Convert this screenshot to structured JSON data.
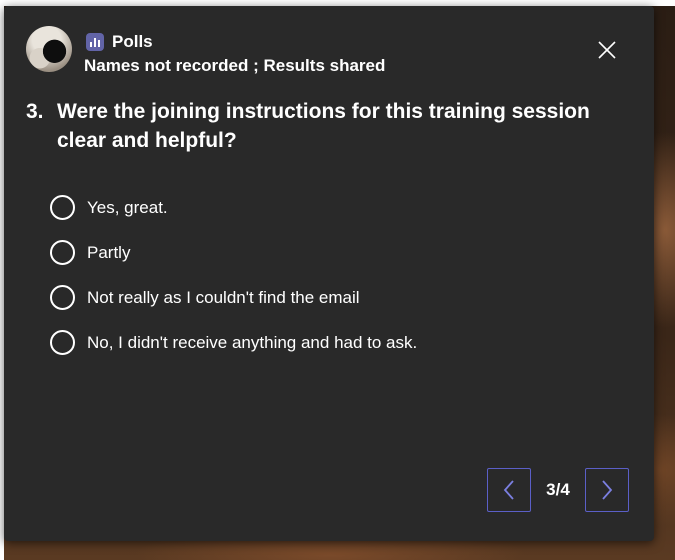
{
  "poll": {
    "app_name": "Polls",
    "subtitle": "Names not recorded ; Results shared",
    "question_number": "3.",
    "question_text": "Were the joining instructions for this training session clear and helpful?",
    "options": [
      {
        "label": "Yes, great.",
        "selected": false
      },
      {
        "label": "Partly",
        "selected": false
      },
      {
        "label": "Not really as I couldn't find the email",
        "selected": false
      },
      {
        "label": "No, I didn't receive anything and had to ask.",
        "selected": false
      }
    ]
  },
  "pagination": {
    "indicator": "3/4"
  },
  "colors": {
    "card_background": "#292929",
    "accent": "#6264a7",
    "nav_border": "#5b5fc7",
    "text": "#ffffff"
  },
  "icons": {
    "app": "polls-icon",
    "close": "close-icon",
    "prev": "chevron-left-icon",
    "next": "chevron-right-icon"
  }
}
